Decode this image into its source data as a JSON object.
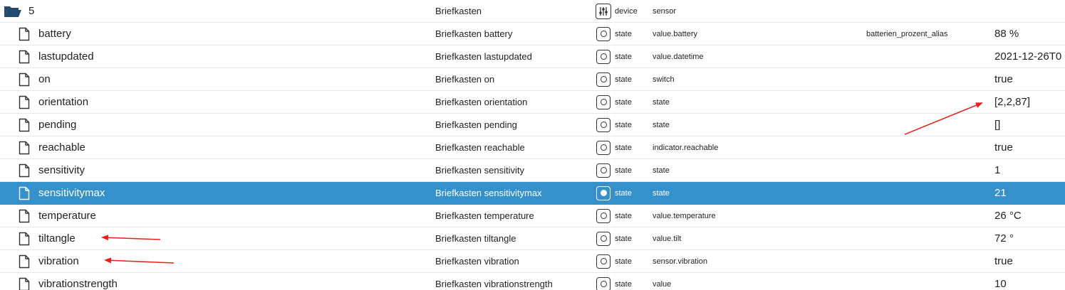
{
  "folder": {
    "id": "5",
    "name": "Briefkasten",
    "type": "device",
    "role": "sensor"
  },
  "rows": [
    {
      "id": "battery",
      "name": "Briefkasten battery",
      "type": "state",
      "role": "value.battery",
      "room": "batterien_prozent_alias",
      "value": "88 %"
    },
    {
      "id": "lastupdated",
      "name": "Briefkasten lastupdated",
      "type": "state",
      "role": "value.datetime",
      "room": "",
      "value": "2021-12-26T0"
    },
    {
      "id": "on",
      "name": "Briefkasten on",
      "type": "state",
      "role": "switch",
      "room": "",
      "value": "true"
    },
    {
      "id": "orientation",
      "name": "Briefkasten orientation",
      "type": "state",
      "role": "state",
      "room": "",
      "value": "[2,2,87]"
    },
    {
      "id": "pending",
      "name": "Briefkasten pending",
      "type": "state",
      "role": "state",
      "room": "",
      "value": "[]"
    },
    {
      "id": "reachable",
      "name": "Briefkasten reachable",
      "type": "state",
      "role": "indicator.reachable",
      "room": "",
      "value": "true"
    },
    {
      "id": "sensitivity",
      "name": "Briefkasten sensitivity",
      "type": "state",
      "role": "state",
      "room": "",
      "value": "1"
    },
    {
      "id": "sensitivitymax",
      "name": "Briefkasten sensitivitymax",
      "type": "state",
      "role": "state",
      "room": "",
      "value": "21"
    },
    {
      "id": "temperature",
      "name": "Briefkasten temperature",
      "type": "state",
      "role": "value.temperature",
      "room": "",
      "value": "26 °C"
    },
    {
      "id": "tiltangle",
      "name": "Briefkasten tiltangle",
      "type": "state",
      "role": "value.tilt",
      "room": "",
      "value": "72 °"
    },
    {
      "id": "vibration",
      "name": "Briefkasten vibration",
      "type": "state",
      "role": "sensor.vibration",
      "room": "",
      "value": "true"
    },
    {
      "id": "vibrationstrength",
      "name": "Briefkasten vibrationstrength",
      "type": "state",
      "role": "value",
      "room": "",
      "value": "10"
    }
  ],
  "icons": {
    "folder": "folder-open-icon",
    "file": "file-icon",
    "device": "device-icon",
    "state": "state-icon"
  },
  "colors": {
    "selected_row": "#3591cb",
    "annotation_arrow": "#e8201a"
  }
}
